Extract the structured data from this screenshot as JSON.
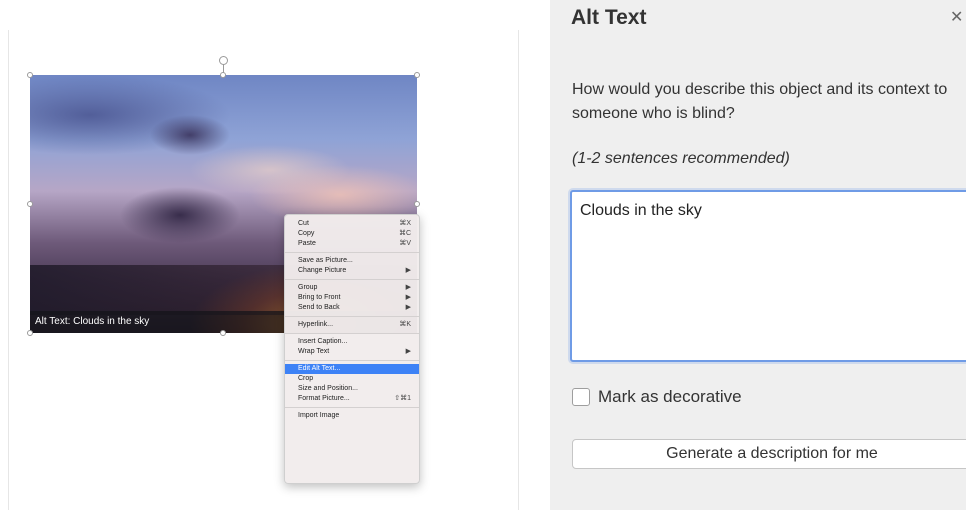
{
  "document": {
    "image_caption": "Alt Text: Clouds in the sky"
  },
  "context_menu": {
    "groups": [
      [
        {
          "label": "Cut",
          "shortcut": "⌘X"
        },
        {
          "label": "Copy",
          "shortcut": "⌘C"
        },
        {
          "label": "Paste",
          "shortcut": "⌘V"
        }
      ],
      [
        {
          "label": "Save as Picture...",
          "shortcut": ""
        },
        {
          "label": "Change Picture",
          "submenu": true
        }
      ],
      [
        {
          "label": "Group",
          "submenu": true
        },
        {
          "label": "Bring to Front",
          "submenu": true
        },
        {
          "label": "Send to Back",
          "submenu": true
        }
      ],
      [
        {
          "label": "Hyperlink...",
          "shortcut": "⌘K"
        }
      ],
      [
        {
          "label": "Insert Caption...",
          "shortcut": ""
        },
        {
          "label": "Wrap Text",
          "submenu": true
        }
      ],
      [
        {
          "label": "Edit Alt Text...",
          "shortcut": "",
          "selected": true
        },
        {
          "label": "Crop",
          "shortcut": ""
        },
        {
          "label": "Size and Position...",
          "shortcut": ""
        },
        {
          "label": "Format Picture...",
          "shortcut": "⇧⌘1"
        }
      ],
      [
        {
          "label": "Import Image",
          "shortcut": ""
        }
      ]
    ],
    "submenu_arrow": "▶"
  },
  "alt_text_pane": {
    "title": "Alt Text",
    "question": "How would you describe this object and its context to someone who is blind?",
    "hint": "(1-2 sentences recommended)",
    "description_value": "Clouds in the sky",
    "decorative_label": "Mark as decorative",
    "decorative_checked": false,
    "generate_button_label": "Generate a description for me"
  },
  "colors": {
    "selection_accent": "#3d82f6",
    "focus_border": "#6f9be6",
    "pane_background": "#efefef"
  },
  "icons": {
    "close": "close-icon",
    "rotate": "rotate-handle-icon",
    "submenu": "chevron-right-icon"
  }
}
